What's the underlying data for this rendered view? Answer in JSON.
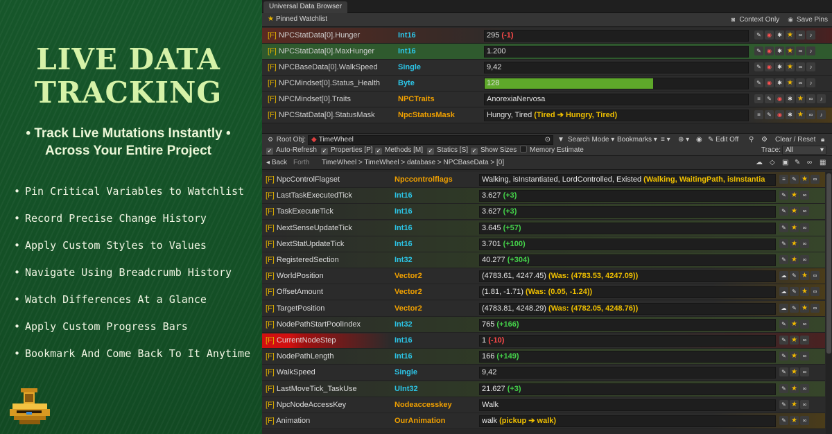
{
  "promo": {
    "title_line1": "LIVE DATA",
    "title_line2": "TRACKING",
    "subtitle_line1": "Track Live Mutations Instantly",
    "subtitle_line2": "Across Your Entire Project",
    "bullet_dot": "•",
    "features": [
      "Pin Critical Variables to Watchlist",
      "Record Precise Change History",
      "Apply Custom Styles to Values",
      "Navigate Using Breadcrumb History",
      "Watch Differences At a Glance",
      "Apply Custom Progress Bars",
      "Bookmark And Come Back To It Anytime"
    ],
    "logo_icon": "toilet-logo-icon"
  },
  "window": {
    "tab_title": "Universal Data Browser"
  },
  "watchlist": {
    "title": "Pinned Watchlist",
    "context_only": "Context Only",
    "save_pins": "Save Pins",
    "rows": [
      {
        "prefix": "[F]",
        "name": "NPCStatData[0].Hunger",
        "type": "Int16",
        "type_color": "#2cc6e8",
        "value": "295",
        "delta": "(-1)",
        "delta_kind": "red",
        "progress": 0.0
      },
      {
        "prefix": "[F]",
        "name": "NPCStatData[0].MaxHunger",
        "type": "Int16",
        "type_color": "#2cc6e8",
        "value": "1.200",
        "delta": "",
        "delta_kind": "",
        "progress": 0.0
      },
      {
        "prefix": "[F]",
        "name": "NPCBaseData[0].WalkSpeed",
        "type": "Single",
        "type_color": "#2cc6e8",
        "value": "9,42",
        "delta": "",
        "delta_kind": "",
        "progress": 0.0
      },
      {
        "prefix": "[F]",
        "name": "NPCMindset[0].Status_Health",
        "type": "Byte",
        "type_color": "#2cc6e8",
        "value": "128",
        "delta": "",
        "delta_kind": "",
        "progress": 0.64
      },
      {
        "prefix": "[F]",
        "name": "NPCMindset[0].Traits",
        "type": "NPCTraits",
        "type_color": "#f0a000",
        "value": "AnorexiaNervosa",
        "delta": "",
        "delta_kind": "",
        "progress": 0.0
      },
      {
        "prefix": "[F]",
        "name": "NPCStatData[0].StatusMask",
        "type": "NpcStatusMask",
        "type_color": "#f0a000",
        "value": "Hungry, Tired",
        "delta": "(Tired ➔ Hungry, Tired)",
        "delta_kind": "yellow",
        "progress": 0.0
      }
    ]
  },
  "toolbar": {
    "root_label": "Root Obj:",
    "root_value": "TimeWheel",
    "search_mode": "Search Mode",
    "bookmarks": "Bookmarks",
    "edit_off": "Edit Off",
    "clear_reset": "Clear / Reset",
    "auto_refresh": "Auto-Refresh",
    "properties": "Properties [P]",
    "methods": "Methods [M]",
    "statics": "Statics [S]",
    "show_sizes": "Show Sizes",
    "memory_estimate": "Memory Estimate",
    "trace_label": "Trace:",
    "trace_value": "All"
  },
  "breadcrumb": {
    "back": "Back",
    "forth": "Forth",
    "path": "TimeWheel  >  TimeWheel  >  database  >  NPCBaseData  >  [0]"
  },
  "properties": [
    {
      "prefix": "[F]",
      "name": "NpcControlFlagset",
      "type": "Npccontrolflags",
      "type_color": "#f0a000",
      "value": "Walking, isInstantiated, LordControlled, Existed",
      "delta": "(Walking, WaitingPath, isInstantia",
      "delta_kind": "yellow",
      "changed": false,
      "name_red": false
    },
    {
      "prefix": "[F]",
      "name": "LastTaskExecutedTick",
      "type": "Int16",
      "type_color": "#2cc6e8",
      "value": "3.627",
      "delta": "(+3)",
      "delta_kind": "green",
      "changed": true,
      "name_red": false
    },
    {
      "prefix": "[F]",
      "name": "TaskExecuteTick",
      "type": "Int16",
      "type_color": "#2cc6e8",
      "value": "3.627",
      "delta": "(+3)",
      "delta_kind": "green",
      "changed": true,
      "name_red": false
    },
    {
      "prefix": "[F]",
      "name": "NextSenseUpdateTick",
      "type": "Int16",
      "type_color": "#2cc6e8",
      "value": "3.645",
      "delta": "(+57)",
      "delta_kind": "green",
      "changed": true,
      "name_red": false
    },
    {
      "prefix": "[F]",
      "name": "NextStatUpdateTick",
      "type": "Int16",
      "type_color": "#2cc6e8",
      "value": "3.701",
      "delta": "(+100)",
      "delta_kind": "green",
      "changed": true,
      "name_red": false
    },
    {
      "prefix": "[F]",
      "name": "RegisteredSection",
      "type": "Int32",
      "type_color": "#2cc6e8",
      "value": "40.277",
      "delta": "(+304)",
      "delta_kind": "green",
      "changed": true,
      "name_red": false
    },
    {
      "prefix": "[F]",
      "name": "WorldPosition",
      "type": "Vector2",
      "type_color": "#f0a000",
      "value": "(4783.61, 4247.45)",
      "delta": "(Was: (4783.53, 4247.09))",
      "delta_kind": "yellow",
      "changed": false,
      "name_red": false
    },
    {
      "prefix": "[F]",
      "name": "OffsetAmount",
      "type": "Vector2",
      "type_color": "#f0a000",
      "value": "(1.81, -1.71)",
      "delta": "(Was: (0.05, -1.24))",
      "delta_kind": "yellow",
      "changed": false,
      "name_red": false
    },
    {
      "prefix": "[F]",
      "name": "TargetPosition",
      "type": "Vector2",
      "type_color": "#f0a000",
      "value": "(4783.81, 4248.29)",
      "delta": "(Was: (4782.05, 4248.76))",
      "delta_kind": "yellow",
      "changed": false,
      "name_red": false
    },
    {
      "prefix": "[F]",
      "name": "NodePathStartPoolIndex",
      "type": "Int32",
      "type_color": "#2cc6e8",
      "value": "765",
      "delta": "(+166)",
      "delta_kind": "green",
      "changed": true,
      "name_red": false
    },
    {
      "prefix": "[F]",
      "name": "CurrentNodeStep",
      "type": "Int16",
      "type_color": "#2cc6e8",
      "value": "1",
      "delta": "(-10)",
      "delta_kind": "red",
      "changed": false,
      "name_red": true
    },
    {
      "prefix": "[F]",
      "name": "NodePathLength",
      "type": "Int16",
      "type_color": "#2cc6e8",
      "value": "166",
      "delta": "(+149)",
      "delta_kind": "green",
      "changed": true,
      "name_red": false
    },
    {
      "prefix": "[F]",
      "name": "WalkSpeed",
      "type": "Single",
      "type_color": "#2cc6e8",
      "value": "9,42",
      "delta": "",
      "delta_kind": "",
      "changed": false,
      "name_red": false
    },
    {
      "prefix": "[F]",
      "name": "LastMoveTick_TaskUse",
      "type": "UInt32",
      "type_color": "#2cc6e8",
      "value": "21.627",
      "delta": "(+3)",
      "delta_kind": "green",
      "changed": true,
      "name_red": false
    },
    {
      "prefix": "[F]",
      "name": "NpcNodeAccessKey",
      "type": "Nodeaccesskey",
      "type_color": "#f0a000",
      "value": "Walk",
      "delta": "",
      "delta_kind": "",
      "changed": false,
      "name_red": false
    },
    {
      "prefix": "[F]",
      "name": "Animation",
      "type": "OurAnimation",
      "type_color": "#f0a000",
      "value": "walk",
      "delta": "(pickup ➔ walk)",
      "delta_kind": "yellow",
      "changed": false,
      "name_red": false
    }
  ]
}
